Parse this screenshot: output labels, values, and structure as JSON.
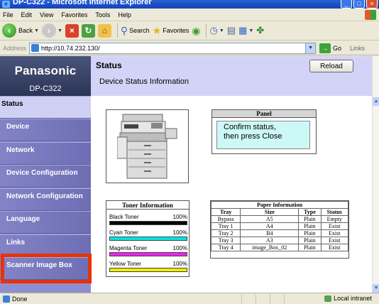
{
  "window": {
    "title": "DP-C322 - Microsoft Internet Explorer"
  },
  "menu": [
    "File",
    "Edit",
    "View",
    "Favorites",
    "Tools",
    "Help"
  ],
  "toolbar": {
    "back": "Back",
    "search": "Search",
    "favorites": "Favorites"
  },
  "address": {
    "label": "Address",
    "url": "http://10.74.232.130/",
    "go": "Go",
    "links": "Links"
  },
  "sidebar": {
    "brand": "Panasonic",
    "model": "DP-C322",
    "items": [
      {
        "label": "Status"
      },
      {
        "label": "Device"
      },
      {
        "label": "Network"
      },
      {
        "label": "Device Configuration"
      },
      {
        "label": "Network Configuration"
      },
      {
        "label": "Language"
      },
      {
        "label": "Links"
      },
      {
        "label": "Scanner Image Box"
      }
    ]
  },
  "header": {
    "title": "Status",
    "subtitle": "Device Status Information",
    "reload": "Reload"
  },
  "panel": {
    "title": "Panel",
    "message_line1": "Confirm status,",
    "message_line2": "then press Close"
  },
  "toner": {
    "title": "Toner Information",
    "items": [
      {
        "name": "Black Toner",
        "percent": "100%",
        "level": 1.0,
        "color": "#000000"
      },
      {
        "name": "Cyan Toner",
        "percent": "100%",
        "level": 1.0,
        "color": "#00e5e5"
      },
      {
        "name": "Magenta Toner",
        "percent": "100%",
        "level": 1.0,
        "color": "#ee22ee"
      },
      {
        "name": "Yellow Toner",
        "percent": "100%",
        "level": 1.0,
        "color": "#eeee00"
      }
    ]
  },
  "paper": {
    "title": "Paper Information",
    "columns": [
      "Tray",
      "Size",
      "Type",
      "Status"
    ],
    "rows": [
      [
        "Bypass",
        "A5",
        "Plain",
        "Empty"
      ],
      [
        "Tray 1",
        "A4",
        "Plain",
        "Exist"
      ],
      [
        "Tray 2",
        "B4",
        "Plain",
        "Exist"
      ],
      [
        "Tray 3",
        "A3",
        "Plain",
        "Exist"
      ],
      [
        "Tray 4",
        "image_Box_02",
        "Plain",
        "Exist"
      ]
    ]
  },
  "status": {
    "left": "Done",
    "zone": "Local intranet"
  }
}
